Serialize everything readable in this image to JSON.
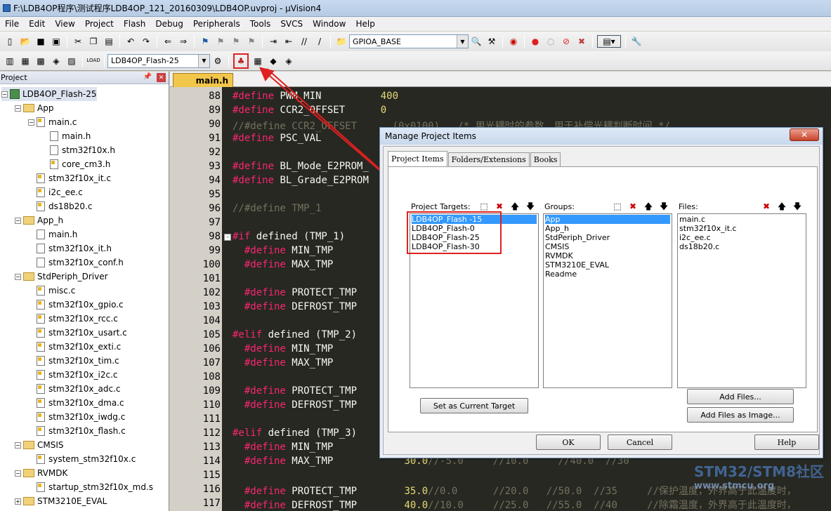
{
  "window": {
    "title": "F:\\LDB4OP程序\\测试程序LDB4OP_121_20160309\\LDB4OP.uvproj - µVision4"
  },
  "menu": [
    "File",
    "Edit",
    "View",
    "Project",
    "Flash",
    "Debug",
    "Peripherals",
    "Tools",
    "SVCS",
    "Window",
    "Help"
  ],
  "toolbar": {
    "peripheral_combo": "GPIOA_BASE",
    "target_combo": "LDB4OP_Flash-25"
  },
  "project_panel": {
    "title": "Project",
    "items": [
      {
        "label": "LDB4OP_Flash-25",
        "depth": 0,
        "kind": "target",
        "exp": "-"
      },
      {
        "label": "App",
        "depth": 1,
        "kind": "folder",
        "exp": "-"
      },
      {
        "label": "main.c",
        "depth": 2,
        "kind": "cfile",
        "exp": "-"
      },
      {
        "label": "main.h",
        "depth": 3,
        "kind": "file",
        "exp": ""
      },
      {
        "label": "stm32f10x.h",
        "depth": 3,
        "kind": "file",
        "exp": ""
      },
      {
        "label": "core_cm3.h",
        "depth": 3,
        "kind": "cfile",
        "exp": ""
      },
      {
        "label": "stm32f10x_it.c",
        "depth": 2,
        "kind": "cfile",
        "exp": ""
      },
      {
        "label": "i2c_ee.c",
        "depth": 2,
        "kind": "cfile",
        "exp": ""
      },
      {
        "label": "ds18b20.c",
        "depth": 2,
        "kind": "cfile",
        "exp": ""
      },
      {
        "label": "App_h",
        "depth": 1,
        "kind": "folder",
        "exp": "-"
      },
      {
        "label": "main.h",
        "depth": 2,
        "kind": "file",
        "exp": ""
      },
      {
        "label": "stm32f10x_it.h",
        "depth": 2,
        "kind": "file",
        "exp": ""
      },
      {
        "label": "stm32f10x_conf.h",
        "depth": 2,
        "kind": "file",
        "exp": ""
      },
      {
        "label": "StdPeriph_Driver",
        "depth": 1,
        "kind": "folder",
        "exp": "-"
      },
      {
        "label": "misc.c",
        "depth": 2,
        "kind": "cfile",
        "exp": ""
      },
      {
        "label": "stm32f10x_gpio.c",
        "depth": 2,
        "kind": "cfile",
        "exp": ""
      },
      {
        "label": "stm32f10x_rcc.c",
        "depth": 2,
        "kind": "cfile",
        "exp": ""
      },
      {
        "label": "stm32f10x_usart.c",
        "depth": 2,
        "kind": "cfile",
        "exp": ""
      },
      {
        "label": "stm32f10x_exti.c",
        "depth": 2,
        "kind": "cfile",
        "exp": ""
      },
      {
        "label": "stm32f10x_tim.c",
        "depth": 2,
        "kind": "cfile",
        "exp": ""
      },
      {
        "label": "stm32f10x_i2c.c",
        "depth": 2,
        "kind": "cfile",
        "exp": ""
      },
      {
        "label": "stm32f10x_adc.c",
        "depth": 2,
        "kind": "cfile",
        "exp": ""
      },
      {
        "label": "stm32f10x_dma.c",
        "depth": 2,
        "kind": "cfile",
        "exp": ""
      },
      {
        "label": "stm32f10x_iwdg.c",
        "depth": 2,
        "kind": "cfile",
        "exp": ""
      },
      {
        "label": "stm32f10x_flash.c",
        "depth": 2,
        "kind": "cfile",
        "exp": ""
      },
      {
        "label": "CMSIS",
        "depth": 1,
        "kind": "folder",
        "exp": "-"
      },
      {
        "label": "system_stm32f10x.c",
        "depth": 2,
        "kind": "cfile",
        "exp": ""
      },
      {
        "label": "RVMDK",
        "depth": 1,
        "kind": "folder",
        "exp": "-"
      },
      {
        "label": "startup_stm32f10x_md.s",
        "depth": 2,
        "kind": "cfile",
        "exp": ""
      },
      {
        "label": "STM3210E_EVAL",
        "depth": 1,
        "kind": "folder",
        "exp": "+"
      }
    ]
  },
  "editor": {
    "tab": "main.h",
    "lines": [
      {
        "n": "88",
        "fold": "",
        "parts": [
          {
            "t": "#define ",
            "c": "k"
          },
          {
            "t": "PWM_MIN          ",
            "c": ""
          },
          {
            "t": "400",
            "c": "n"
          }
        ]
      },
      {
        "n": "89",
        "fold": "",
        "parts": [
          {
            "t": "#define ",
            "c": "k"
          },
          {
            "t": "CCR2_OFFSET      ",
            "c": ""
          },
          {
            "t": "0",
            "c": "n"
          }
        ]
      },
      {
        "n": "90",
        "fold": "",
        "parts": [
          {
            "t": "//#define CCR2_OFFSET      (0x0100)   /* 用光耦时的参数，用于补偿光耦判断时间 */",
            "c": "c"
          }
        ]
      },
      {
        "n": "91",
        "fold": "",
        "parts": [
          {
            "t": "#define ",
            "c": "k"
          },
          {
            "t": "PSC_VAL",
            "c": ""
          }
        ]
      },
      {
        "n": "92",
        "fold": "",
        "parts": []
      },
      {
        "n": "93",
        "fold": "",
        "parts": [
          {
            "t": "#define ",
            "c": "k"
          },
          {
            "t": "BL_Mode_E2PROM_",
            "c": ""
          }
        ]
      },
      {
        "n": "94",
        "fold": "",
        "parts": [
          {
            "t": "#define ",
            "c": "k"
          },
          {
            "t": "BL_Grade_E2PROM",
            "c": ""
          }
        ]
      },
      {
        "n": "95",
        "fold": "",
        "parts": []
      },
      {
        "n": "96",
        "fold": "",
        "parts": [
          {
            "t": "//#define TMP_1",
            "c": "c"
          }
        ]
      },
      {
        "n": "97",
        "fold": "",
        "parts": []
      },
      {
        "n": "98",
        "fold": "-",
        "parts": [
          {
            "t": "#if ",
            "c": "k"
          },
          {
            "t": "defined (TMP_1)",
            "c": ""
          }
        ]
      },
      {
        "n": "99",
        "fold": "",
        "parts": [
          {
            "t": "  #define ",
            "c": "k"
          },
          {
            "t": "MIN_TMP",
            "c": ""
          }
        ]
      },
      {
        "n": "100",
        "fold": "",
        "parts": [
          {
            "t": "  #define ",
            "c": "k"
          },
          {
            "t": "MAX_TMP",
            "c": ""
          }
        ]
      },
      {
        "n": "101",
        "fold": "",
        "parts": []
      },
      {
        "n": "102",
        "fold": "",
        "parts": [
          {
            "t": "  #define ",
            "c": "k"
          },
          {
            "t": "PROTECT_TMP",
            "c": ""
          }
        ]
      },
      {
        "n": "103",
        "fold": "",
        "parts": [
          {
            "t": "  #define ",
            "c": "k"
          },
          {
            "t": "DEFROST_TMP",
            "c": ""
          }
        ]
      },
      {
        "n": "104",
        "fold": "",
        "parts": []
      },
      {
        "n": "105",
        "fold": "",
        "parts": [
          {
            "t": "#elif ",
            "c": "k"
          },
          {
            "t": "defined (TMP_2)",
            "c": ""
          }
        ]
      },
      {
        "n": "106",
        "fold": "",
        "parts": [
          {
            "t": "  #define ",
            "c": "k"
          },
          {
            "t": "MIN_TMP",
            "c": ""
          }
        ]
      },
      {
        "n": "107",
        "fold": "",
        "parts": [
          {
            "t": "  #define ",
            "c": "k"
          },
          {
            "t": "MAX_TMP",
            "c": ""
          }
        ]
      },
      {
        "n": "108",
        "fold": "",
        "parts": []
      },
      {
        "n": "109",
        "fold": "",
        "parts": [
          {
            "t": "  #define ",
            "c": "k"
          },
          {
            "t": "PROTECT_TMP",
            "c": ""
          }
        ]
      },
      {
        "n": "110",
        "fold": "",
        "parts": [
          {
            "t": "  #define ",
            "c": "k"
          },
          {
            "t": "DEFROST_TMP",
            "c": ""
          }
        ]
      },
      {
        "n": "111",
        "fold": "",
        "parts": []
      },
      {
        "n": "112",
        "fold": "",
        "parts": [
          {
            "t": "#elif ",
            "c": "k"
          },
          {
            "t": "defined (TMP_3)",
            "c": ""
          }
        ]
      },
      {
        "n": "113",
        "fold": "",
        "parts": [
          {
            "t": "  #define ",
            "c": "k"
          },
          {
            "t": "MIN_TMP",
            "c": ""
          }
        ]
      },
      {
        "n": "114",
        "fold": "",
        "parts": [
          {
            "t": "  #define ",
            "c": "k"
          },
          {
            "t": "MAX_TMP            ",
            "c": ""
          },
          {
            "t": "30.0",
            "c": "n"
          },
          {
            "t": "//-5.0     //10.0     //40.0  //30",
            "c": "c"
          }
        ]
      },
      {
        "n": "115",
        "fold": "",
        "parts": []
      },
      {
        "n": "116",
        "fold": "",
        "parts": [
          {
            "t": "  #define ",
            "c": "k"
          },
          {
            "t": "PROTECT_TMP        ",
            "c": ""
          },
          {
            "t": "35.0",
            "c": "n"
          },
          {
            "t": "//0.0      //20.0   //50.0  //35     //保护温度，外界高于此温度时，",
            "c": "c"
          }
        ]
      },
      {
        "n": "117",
        "fold": "",
        "parts": [
          {
            "t": "  #define ",
            "c": "k"
          },
          {
            "t": "DEFROST_TMP        ",
            "c": ""
          },
          {
            "t": "40.0",
            "c": "n"
          },
          {
            "t": "//10.0     //25.0   //55.0  //40     //除霜温度，外界高于此温度时，",
            "c": "c"
          }
        ]
      }
    ]
  },
  "dialog": {
    "title": "Manage Project Items",
    "close": "✕",
    "tabs": [
      "Project Items",
      "Folders/Extensions",
      "Books"
    ],
    "targets_label": "Project Targets:",
    "groups_label": "Groups:",
    "files_label": "Files:",
    "targets": [
      "LDB4OP_Flash -15",
      "LDB4OP_Flash-0",
      "LDB4OP_Flash-25",
      "LDB4OP_Flash-30"
    ],
    "groups": [
      "App",
      "App_h",
      "StdPeriph_Driver",
      "CMSIS",
      "RVMDK",
      "STM3210E_EVAL",
      "Readme"
    ],
    "files": [
      "main.c",
      "stm32f10x_it.c",
      "i2c_ee.c",
      "ds18b20.c"
    ],
    "set_current": "Set as Current Target",
    "add_files": "Add Files...",
    "add_image": "Add Files as Image...",
    "ok": "OK",
    "cancel": "Cancel",
    "help": "Help"
  },
  "watermark": {
    "text": "STM32/STM8社区",
    "sub": "www.stmcu.org"
  },
  "colors": {
    "highlight": "#e02020",
    "selection": "#3399ff",
    "editor_bg": "#272822"
  }
}
